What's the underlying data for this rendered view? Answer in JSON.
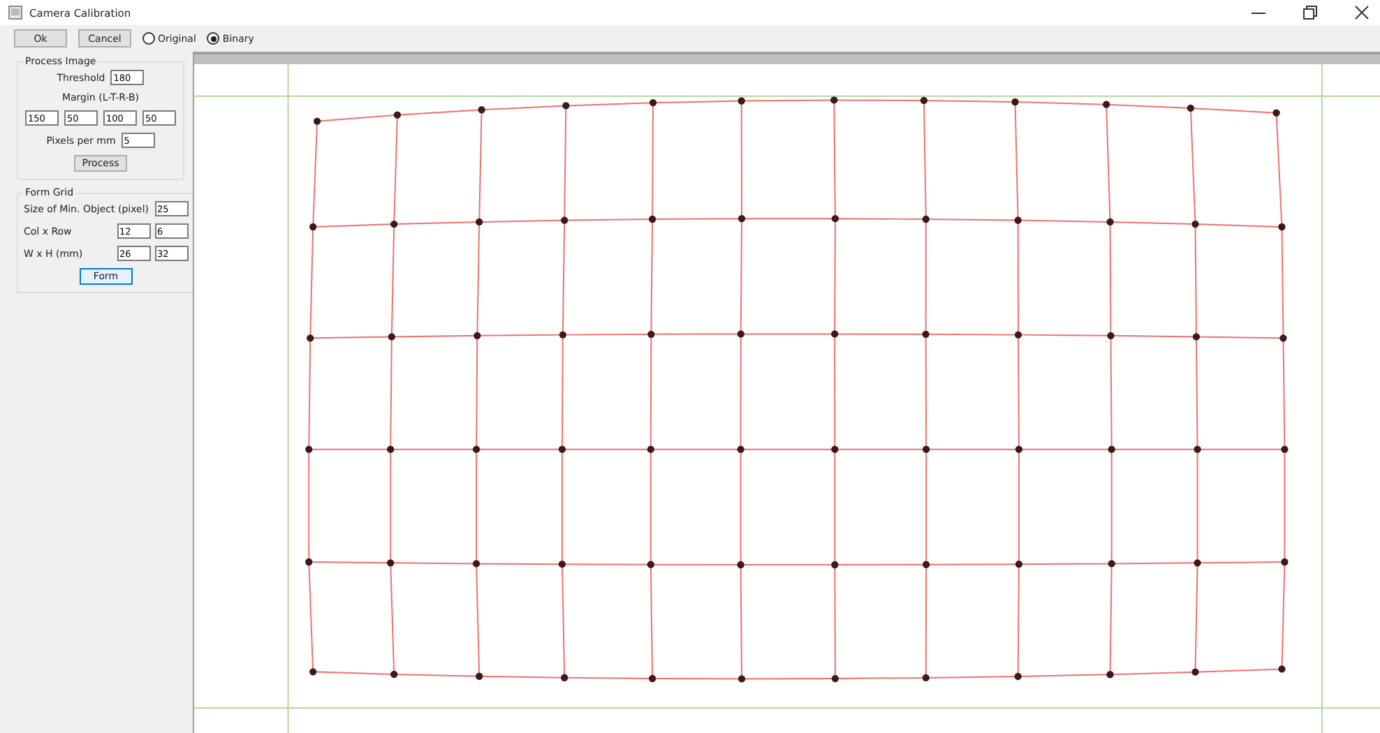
{
  "window": {
    "title": "Camera Calibration"
  },
  "toolbar": {
    "buttons": [
      "Ok",
      "Cancel"
    ],
    "radios": [
      {
        "label": "Original",
        "selected": false
      },
      {
        "label": "Binary",
        "selected": true
      }
    ]
  },
  "process_image": {
    "title": "Process Image",
    "threshold_label": "Threshold",
    "threshold": "180",
    "margin_label": "Margin (L-T-R-B)",
    "margins": [
      "150",
      "50",
      "100",
      "50"
    ],
    "pixels_label": "Pixels per mm",
    "pixels": "5",
    "button": "Process"
  },
  "form_grid": {
    "title": "Form Grid",
    "fields": [
      {
        "label": "Size of Min. Object (pixel)",
        "values": [
          "25"
        ]
      },
      {
        "label": "Col x Row",
        "values": [
          "12",
          "6"
        ]
      },
      {
        "label": "W x H (mm)",
        "values": [
          "26",
          "32"
        ]
      }
    ],
    "button": "Form"
  }
}
